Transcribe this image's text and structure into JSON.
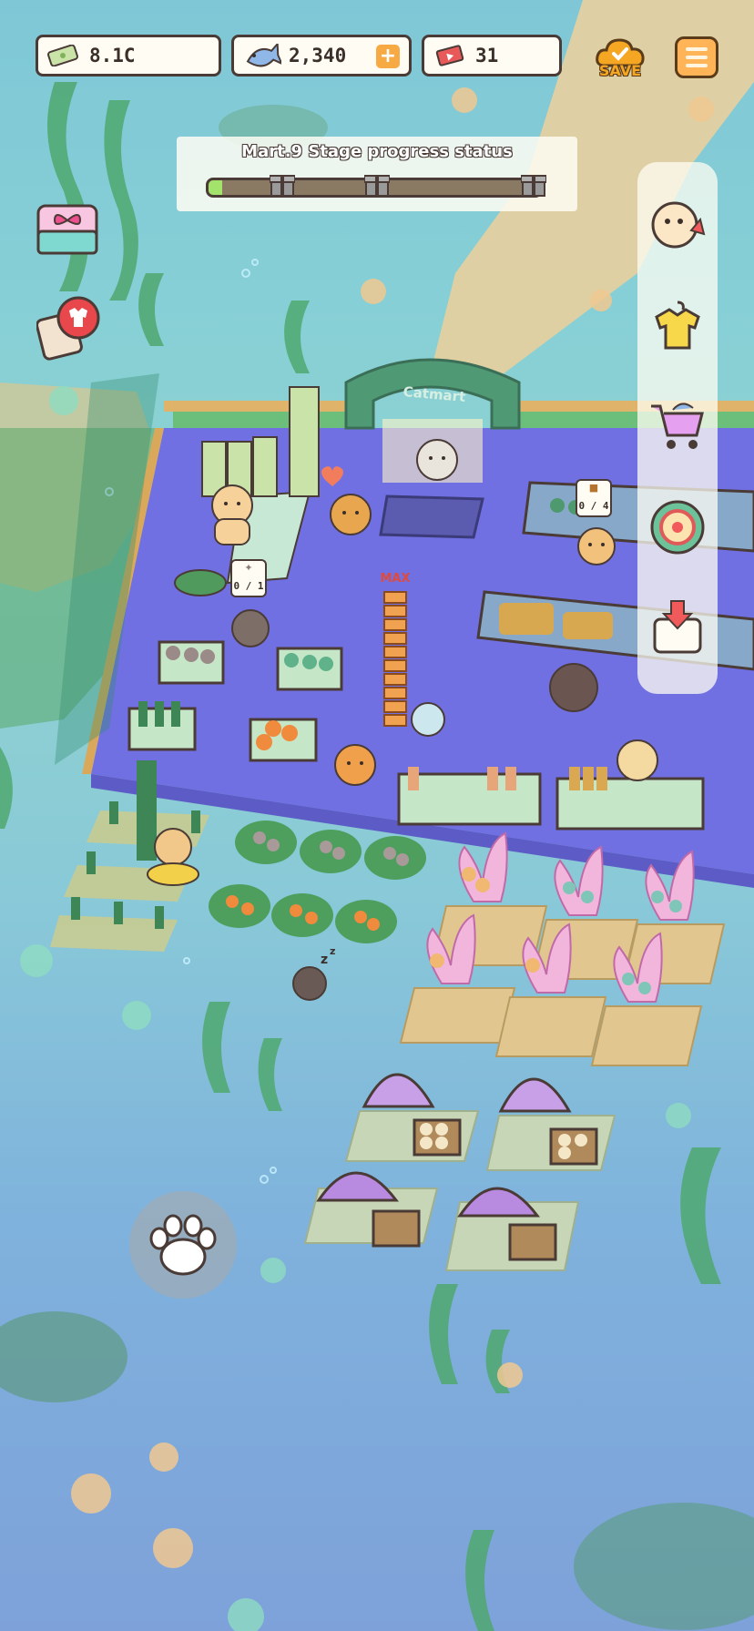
{
  "hud": {
    "cash": {
      "value": "8.1C",
      "icon": "cash-icon"
    },
    "fish": {
      "value": "2,340",
      "icon": "fish-icon",
      "add_icon": "plus-icon"
    },
    "tickets": {
      "value": "31",
      "icon": "ticket-icon"
    },
    "save": {
      "label": "SAVE",
      "icon": "cloud-save-icon"
    },
    "menu": {
      "icon": "hamburger-menu-icon"
    }
  },
  "progress": {
    "title": "Mart.9 Stage progress status",
    "fill_fraction": 0.04,
    "milestones": 3
  },
  "left_buttons": [
    {
      "name": "gift-shop-button",
      "icon": "gift-box-icon"
    },
    {
      "name": "outfit-quest-button",
      "icon": "shirt-badge-icon"
    }
  ],
  "side_menu": [
    {
      "name": "staff-upgrade-button",
      "icon": "cat-upgrade-icon"
    },
    {
      "name": "costume-button",
      "icon": "shirt-hanger-icon"
    },
    {
      "name": "shop-cart-button",
      "icon": "shopping-cart-icon"
    },
    {
      "name": "lucky-wheel-button",
      "icon": "roulette-wheel-icon"
    },
    {
      "name": "recycle-button",
      "icon": "recycle-arrow-icon"
    }
  ],
  "scene": {
    "shop_sign": "Catmart",
    "stock_badges": [
      {
        "label": "0 / 1"
      },
      {
        "label": "0 / 4"
      }
    ],
    "max_label": "MAX"
  },
  "paw_button": {
    "icon": "paw-icon"
  },
  "colors": {
    "accent_orange": "#f5a623",
    "outline_brown": "#4a3b36",
    "progress_green": "#a3e36b",
    "floor_blue": "#7070e0"
  }
}
